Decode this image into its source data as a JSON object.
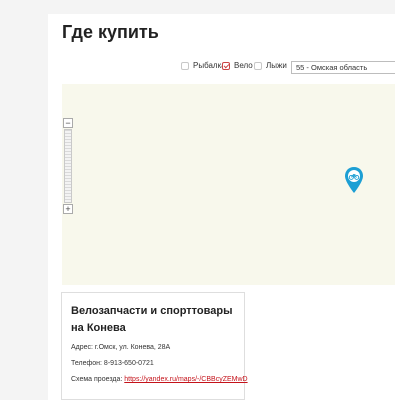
{
  "page": {
    "title": "Где купить"
  },
  "filters": [
    {
      "label": "Рыбалка",
      "checked": false
    },
    {
      "label": "Вело",
      "checked": true
    },
    {
      "label": "Лыжи",
      "checked": false
    }
  ],
  "region_select": {
    "value": "55 - Омская область"
  },
  "map": {
    "zoom_in": "+",
    "zoom_out": "−",
    "marker_icon": "bicycle-map-pin-icon"
  },
  "store": {
    "name_line1": "Велозапчасти и спорттовары",
    "name_line2": "на Конева",
    "address": "Адрес: г.Омск, ул. Конева, 28А",
    "phone": "Телефон: 8-913-650-0721",
    "route_label": "Схема проезда: ",
    "route_link": "https://yandex.ru/maps/-/CBBcyZEMwD"
  },
  "colors": {
    "accent": "#c4121a",
    "marker": "#1d9fd4",
    "map_bg": "#f8f8ec"
  }
}
